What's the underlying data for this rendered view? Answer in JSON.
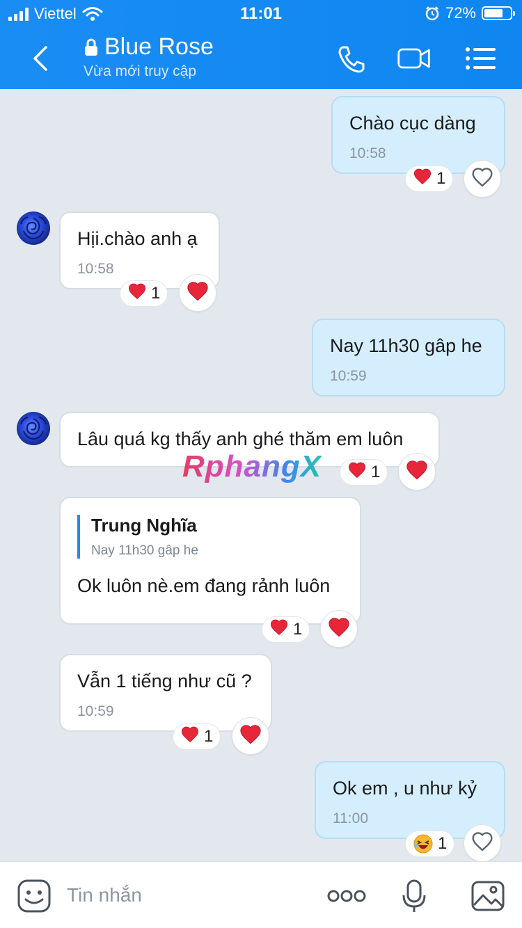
{
  "status_bar": {
    "carrier": "Viettel",
    "time": "11:01",
    "battery": "72%",
    "battery_level": 0.72
  },
  "header": {
    "title": "Blue Rose",
    "subtitle": "Vừa mới truy cập"
  },
  "messages": [
    {
      "text": "Chào cục dàng",
      "time": "10:58",
      "reaction_count": "1"
    },
    {
      "text": "Hịi.chào anh ạ",
      "time": "10:58",
      "reaction_count": "1"
    },
    {
      "text": "Nay 11h30 gâp he",
      "time": "10:59"
    },
    {
      "text": "Lâu quá kg thấy anh ghé thăm em luôn",
      "reaction_count": "1"
    },
    {
      "quote_name": "Trung Nghĩa",
      "quote_text": "Nay 11h30 gâp he",
      "text": "Ok luôn nè.em đang rảnh luôn",
      "reaction_count": "1"
    },
    {
      "text": "Vẫn 1 tiếng như cũ ?",
      "time": "10:59",
      "reaction_count": "1"
    },
    {
      "text": "Ok em , u như kỷ",
      "time": "11:00",
      "reaction_count": "1"
    }
  ],
  "watermark": "RphangX",
  "composer": {
    "placeholder": "Tin nhắn"
  },
  "colors": {
    "header": "#1a8df5",
    "sent_bubble": "#d4eefd",
    "heart": "#e8263a"
  }
}
